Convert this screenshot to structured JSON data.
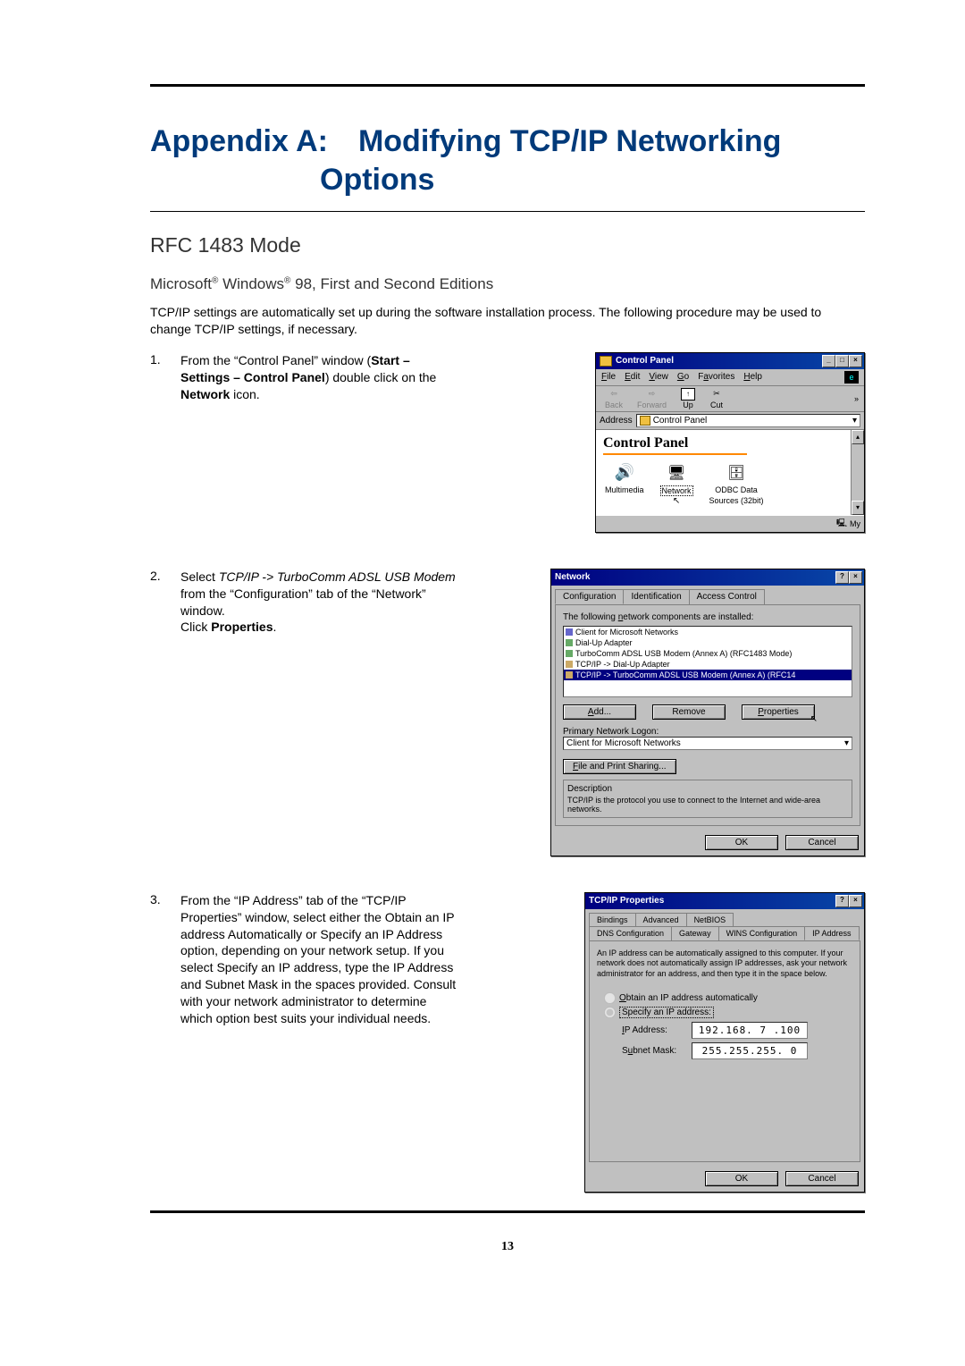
{
  "doc": {
    "title_line1": "Appendix A: Modifying TCP/IP Networking",
    "title_line2": "Options",
    "h2": "RFC 1483 Mode",
    "h3_pre": "Microsoft",
    "h3_mid": " Windows",
    "h3_post": " 98, First and Second Editions",
    "intro": "TCP/IP settings are automatically set up during the software installation process. The following procedure may be used to change TCP/IP settings, if necessary.",
    "step1_num": "1.",
    "step1_a": "From the “Control Panel” window (",
    "step1_b": "Start – Settings – Control Panel",
    "step1_c": ") double click on the ",
    "step1_d": "Network",
    "step1_e": " icon.",
    "step2_num": "2.",
    "step2_a": "Select ",
    "step2_b": "TCP/IP -> TurboComm ADSL USB Modem",
    "step2_c": " from the “Configuration” tab of the “Network” window.",
    "step2_d": "Click ",
    "step2_e": "Properties",
    "step2_f": ".",
    "step3_num": "3.",
    "step3": "From the “IP Address” tab of the “TCP/IP Properties” window, select either the Obtain an IP address Automatically or Specify an IP Address option, depending on your network setup. If you select Specify an IP address, type the IP Address and Subnet Mask in the spaces provided. Consult with your network administrator to determine which option best suits your individual needs.",
    "page_number": "13"
  },
  "cp": {
    "title": "Control Panel",
    "menus": {
      "file": "File",
      "edit": "Edit",
      "view": "View",
      "go": "Go",
      "fav": "Favorites",
      "help": "Help"
    },
    "tools": {
      "back": "Back",
      "forward": "Forward",
      "up": "Up",
      "cut": "Cut"
    },
    "addr_label": "Address",
    "addr_value": "Control Panel",
    "heading": "Control Panel",
    "icons": {
      "multimedia": "Multimedia",
      "network": "Network",
      "odbc1": "ODBC Data",
      "odbc2": "Sources (32bit)"
    },
    "status": "My"
  },
  "net": {
    "title": "Network",
    "tabs": {
      "config": "Configuration",
      "ident": "Identification",
      "access": "Access Control"
    },
    "label_installed": "The following network components are installed:",
    "rows": {
      "r1": "Client for Microsoft Networks",
      "r2": "Dial-Up Adapter",
      "r3": "TurboComm ADSL USB Modem (Annex A) (RFC1483 Mode)",
      "r4": "TCP/IP -> Dial-Up Adapter",
      "r5": "TCP/IP -> TurboComm ADSL USB Modem (Annex A) (RFC14"
    },
    "btn_add": "Add...",
    "btn_remove": "Remove",
    "btn_props": "Properties",
    "label_logon": "Primary Network Logon:",
    "logon_value": "Client for Microsoft Networks",
    "btn_fileshare": "File and Print Sharing...",
    "grp_desc": "Description",
    "desc_text": "TCP/IP is the protocol you use to connect to the Internet and wide-area networks.",
    "ok": "OK",
    "cancel": "Cancel"
  },
  "tcp": {
    "title": "TCP/IP Properties",
    "tabs": {
      "bindings": "Bindings",
      "advanced": "Advanced",
      "netbios": "NetBIOS",
      "dns": "DNS Configuration",
      "gateway": "Gateway",
      "wins": "WINS Configuration",
      "ipaddr": "IP Address"
    },
    "blurb": "An IP address can be automatically assigned to this computer. If your network does not automatically assign IP addresses, ask your network administrator for an address, and then type it in the space below.",
    "opt_auto": "Obtain an IP address automatically",
    "opt_spec": "Specify an IP address:",
    "lbl_ip": "IP Address:",
    "val_ip": "192.168. 7 .100",
    "lbl_mask": "Subnet Mask:",
    "val_mask": "255.255.255. 0",
    "ok": "OK",
    "cancel": "Cancel"
  }
}
